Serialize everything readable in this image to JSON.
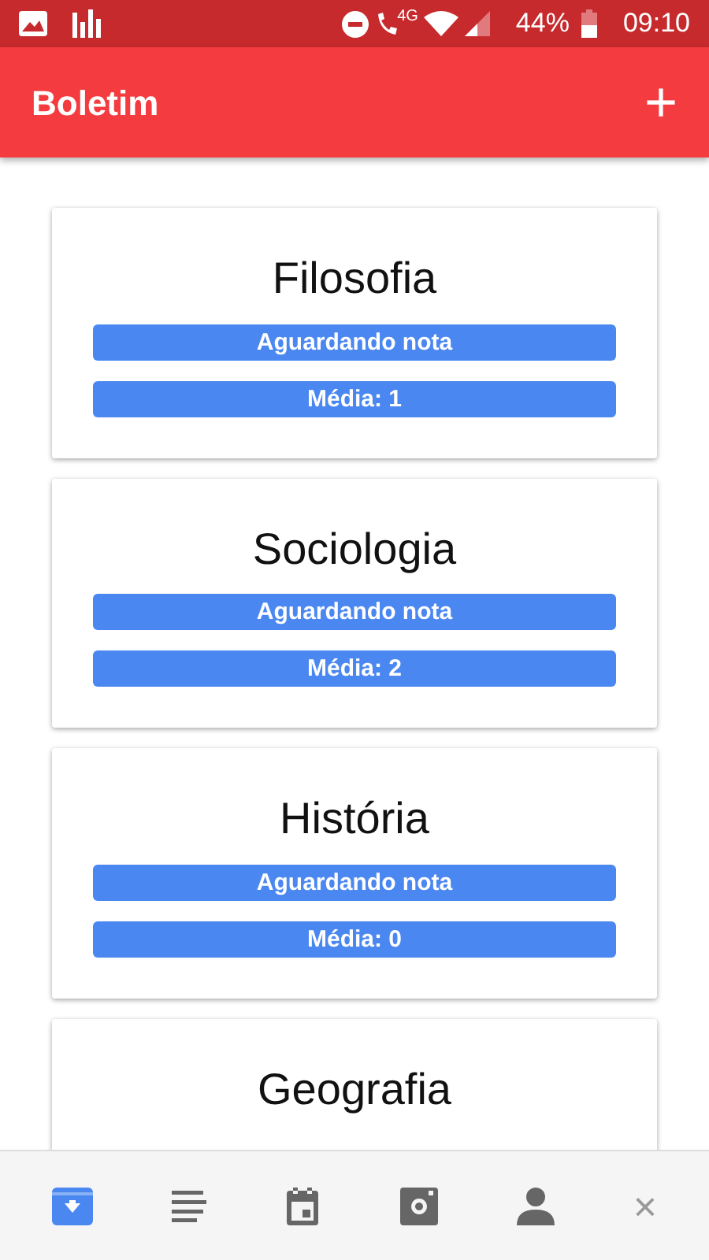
{
  "status_bar": {
    "network": "4G",
    "battery": "44%",
    "time": "09:10"
  },
  "app_bar": {
    "title": "Boletim",
    "action": "+"
  },
  "subjects": [
    {
      "name": "Filosofia",
      "status": "Aguardando nota",
      "average": "Média: 1"
    },
    {
      "name": "Sociologia",
      "status": "Aguardando nota",
      "average": "Média: 2"
    },
    {
      "name": "História",
      "status": "Aguardando nota",
      "average": "Média: 0"
    },
    {
      "name": "Geografia"
    }
  ],
  "bottom_nav": [
    {
      "kind": "inbox",
      "selected": true
    },
    {
      "kind": "list",
      "selected": false
    },
    {
      "kind": "calendar",
      "selected": false
    },
    {
      "kind": "camera",
      "selected": false
    },
    {
      "kind": "person",
      "selected": false
    },
    {
      "kind": "close",
      "label": "×",
      "selected": false
    }
  ]
}
